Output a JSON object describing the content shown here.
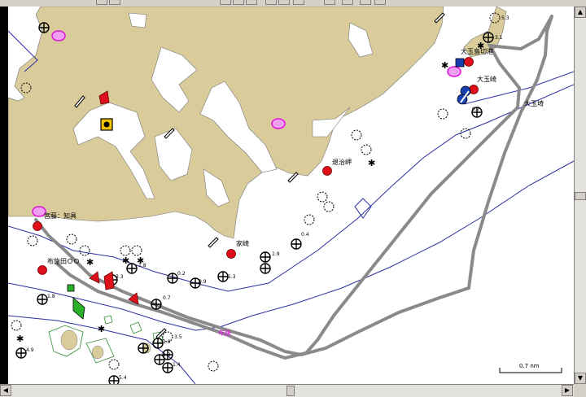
{
  "labels": {
    "oshima_port": "大玉島切港",
    "oshima_cape": "大玉崎",
    "oshima_east": "大玉埼",
    "taiji_cape": "退治岬",
    "house_cape": "家崎",
    "narrow_point": "宮藤：知具",
    "fuse_point": "布施田ＯＯ",
    "pink_label": "布施"
  },
  "depths": [
    "5.3",
    "3.1",
    "0.7",
    "1.8",
    "1.9",
    "0.4",
    "0.9",
    "1.3",
    "0.2",
    "3.3",
    "0.7",
    "1.8",
    "4.9",
    "3.5",
    "1.9",
    "1.3",
    "1.4",
    "5.4"
  ],
  "scale": {
    "label": "0.7 nm"
  },
  "colors": {
    "land": "#d9cc9a",
    "water": "#ffffff",
    "contour": "#2b2f9e",
    "track": "#8a8a8a",
    "marker_red": "#e0101a",
    "marker_magenta": "#e010e0"
  },
  "icons": [
    "circle-cross-icon",
    "rock-icon",
    "red-light-icon",
    "magenta-light-icon",
    "buoy-icon",
    "scroll-arrow-icon"
  ]
}
